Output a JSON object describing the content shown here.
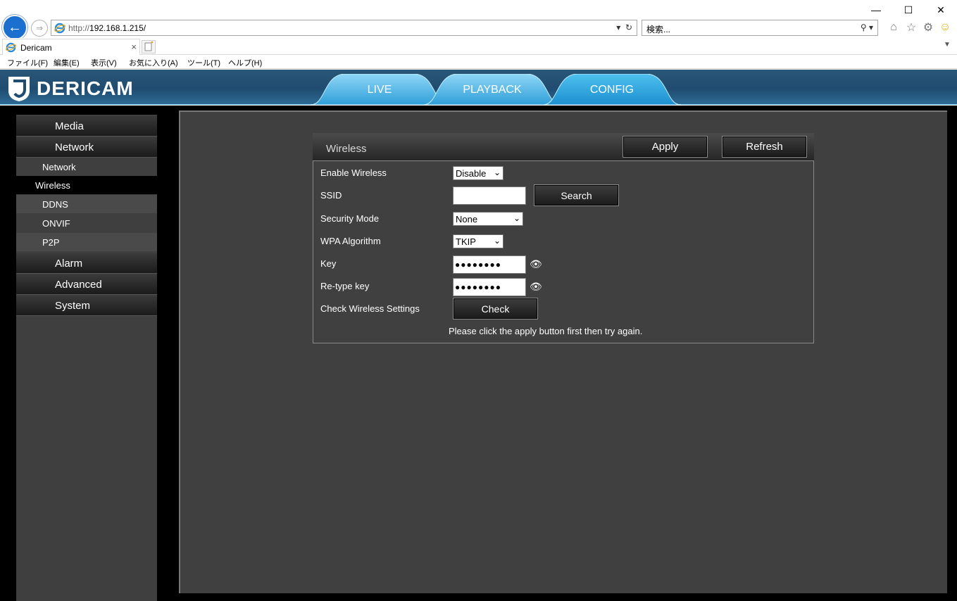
{
  "browser": {
    "address": {
      "proto": "http://",
      "host": "192.168.1.215/"
    },
    "search_placeholder": "検索...",
    "tab_title": "Dericam",
    "tab_close": "×",
    "menu": [
      "ファイル(F)",
      "編集(E)",
      "表示(V)",
      "お気に入り(A)",
      "ツール(T)",
      "ヘルプ(H)"
    ]
  },
  "header": {
    "logo_text": "DERICAM",
    "tabs": [
      "LIVE",
      "PLAYBACK",
      "CONFIG"
    ],
    "active_tab": "CONFIG"
  },
  "sidebar": {
    "sections": [
      "Media",
      "Network",
      "Alarm",
      "Advanced",
      "System"
    ],
    "network_items": [
      "Network",
      "Wireless",
      "DDNS",
      "ONVIF",
      "P2P"
    ],
    "active_item": "Wireless"
  },
  "wireless": {
    "title": "Wireless",
    "apply_label": "Apply",
    "refresh_label": "Refresh",
    "enable_label": "Enable Wireless",
    "enable_value": "Disable",
    "ssid_label": "SSID",
    "ssid_value": "",
    "search_label": "Search",
    "security_label": "Security Mode",
    "security_value": "None",
    "wpa_label": "WPA Algorithm",
    "wpa_value": "TKIP",
    "key_label": "Key",
    "key_value": "●●●●●●●●",
    "retype_label": "Re-type key",
    "retype_value": "●●●●●●●●",
    "check_label": "Check Wireless Settings",
    "check_button": "Check",
    "note": "Please click the apply button first then try again."
  },
  "colors": {
    "header_blue": "#1f4c70",
    "tab_cyan": "#47b8e8",
    "panel_gray": "#404040",
    "sidebar_gray": "#3f3f3f"
  }
}
